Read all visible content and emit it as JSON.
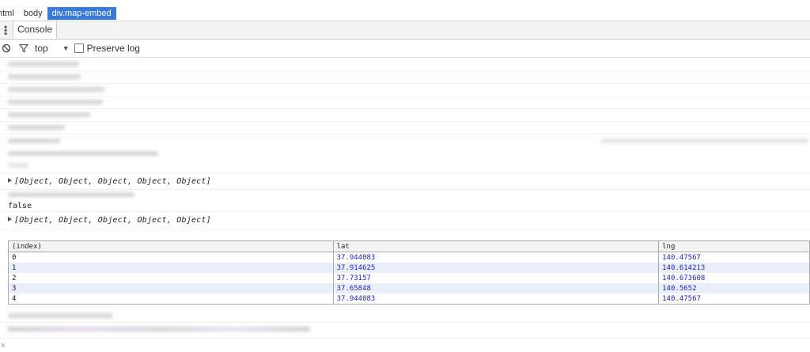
{
  "breadcrumbs": [
    "html",
    "body",
    "div.map-embed"
  ],
  "tabs": [
    "Console"
  ],
  "toolbar": {
    "context": "top",
    "dropdown_glyph": "▼",
    "preserve_log_label": "Preserve log",
    "preserve_log_checked": false
  },
  "console": {
    "array_summary_1": "[Object, Object, Object, Object, Object]",
    "false_value": "false",
    "array_summary_2": "[Object, Object, Object, Object, Object]",
    "table": {
      "headers": [
        "(index)",
        "lat",
        "lng"
      ],
      "rows": [
        [
          "0",
          "37.944083",
          "140.47567"
        ],
        [
          "1",
          "37.914625",
          "140.614213"
        ],
        [
          "2",
          "37.73157",
          "140.673608"
        ],
        [
          "3",
          "37.65848",
          "140.5652"
        ],
        [
          "4",
          "37.944083",
          "140.47567"
        ]
      ]
    },
    "prompt_glyph": "›"
  },
  "colors": {
    "accent": "#3879d9",
    "number": "#1f1fbf",
    "row_highlight": "#e9eff9"
  },
  "icons": [
    "kebab-icon",
    "clear-console-icon",
    "filter-icon",
    "dropdown-arrow-icon",
    "checkbox-icon",
    "expand-triangle-icon"
  ]
}
